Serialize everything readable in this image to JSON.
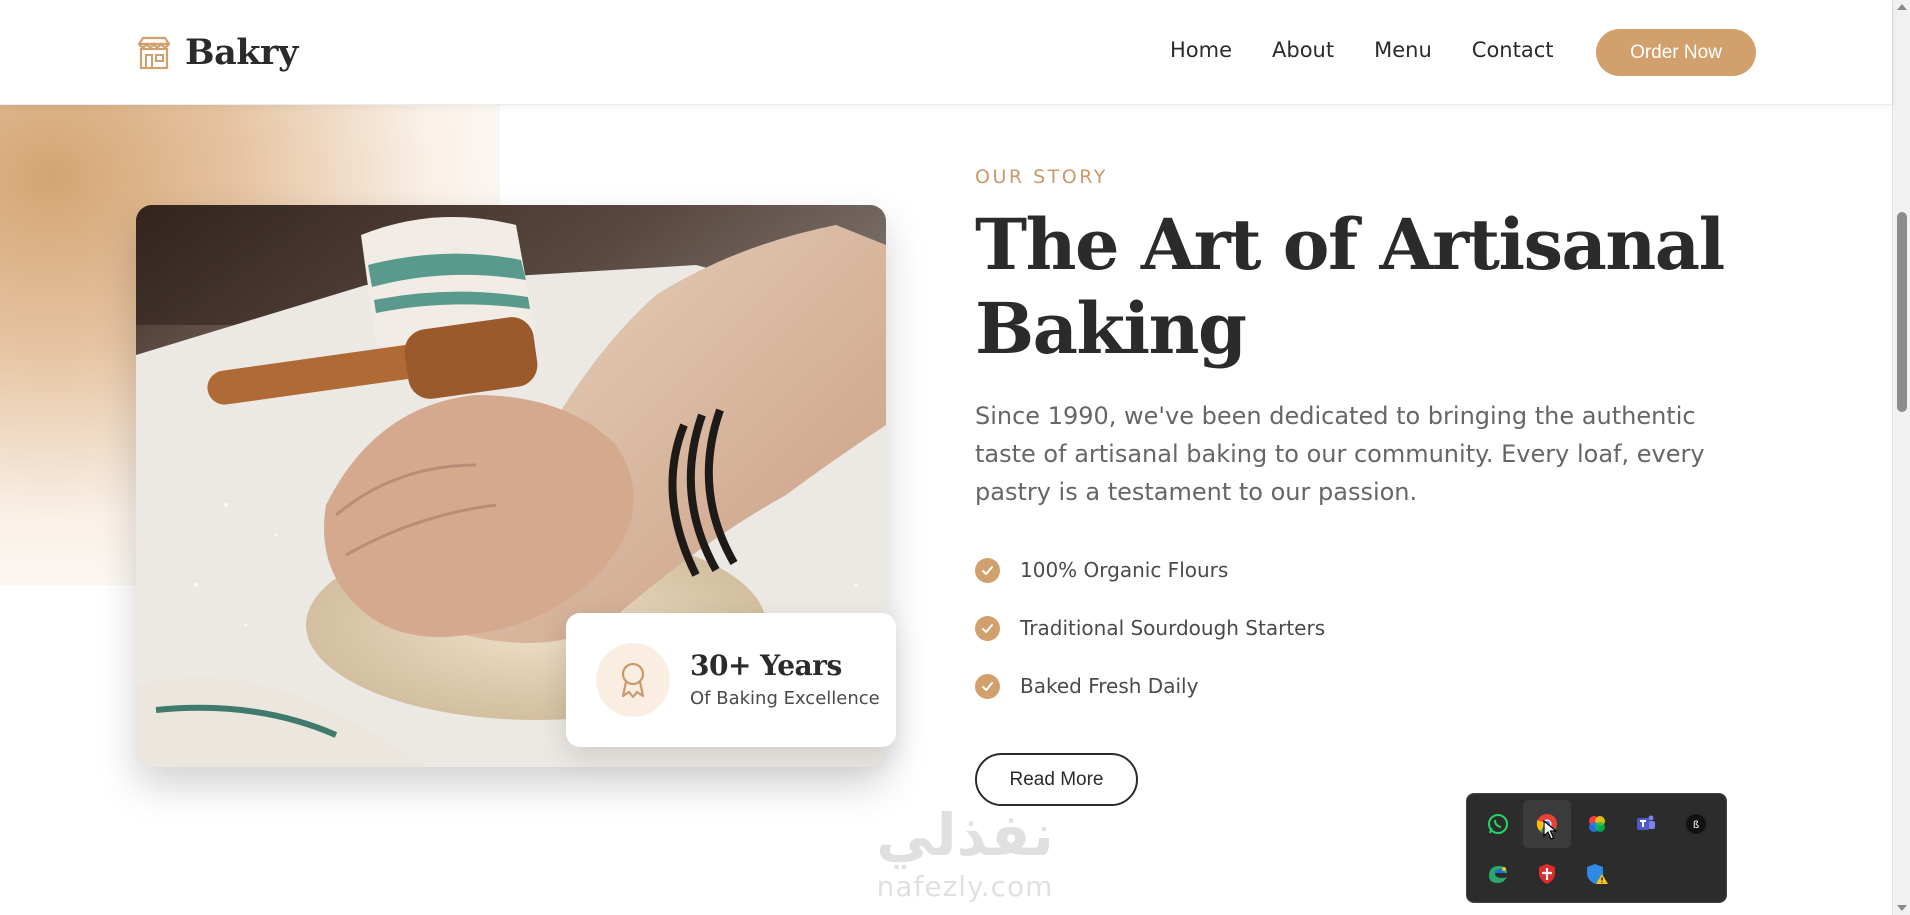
{
  "brand": {
    "name": "Bakry",
    "icon": "shop-icon"
  },
  "nav": {
    "links": [
      "Home",
      "About",
      "Menu",
      "Contact"
    ],
    "cta": "Order Now"
  },
  "hero": {
    "eyebrow": "OUR STORY",
    "headline": "The Art of Artisanal Baking",
    "lead": "Since 1990, we've been dedicated to bringing the authentic taste of artisanal baking to our community. Every loaf, every pastry is a testament to our passion.",
    "features": [
      "100% Organic Flours",
      "Traditional Sourdough Starters",
      "Baked Fresh Daily"
    ],
    "read_more": "Read More",
    "badge": {
      "title": "30+ Years",
      "subtitle": "Of Baking Excellence",
      "icon": "award-icon"
    },
    "image": "hands-kneading-dough-photo"
  },
  "watermark": {
    "arabic": "نفذلي",
    "latin": "nafezly.com"
  },
  "tray": {
    "icons": [
      "whatsapp-icon",
      "chrome-icon",
      "color-wheel-icon",
      "teams-icon",
      "app-icon",
      "edge-dev-icon",
      "shield-icon",
      "windows-security-icon"
    ]
  },
  "colors": {
    "accent": "#d2a06c",
    "text": "#2b2b2b",
    "muted": "#666666",
    "eyebrow": "#c9996a"
  }
}
